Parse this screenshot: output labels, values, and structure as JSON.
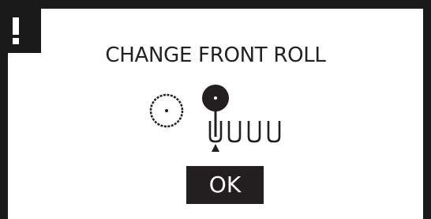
{
  "dialog": {
    "title": "CHANGE FRONT ROLL",
    "ok_label": "OK"
  },
  "icons": {
    "alert": "exclamation-icon",
    "empty_roll": "empty-roll-icon",
    "full_roll": "full-roll-icon",
    "roll_holders": "roll-holder-icon",
    "position_indicator": "up-arrow-icon"
  },
  "colors": {
    "frame": "#1a1a1a",
    "background": "#ffffff",
    "foreground": "#231f20"
  }
}
